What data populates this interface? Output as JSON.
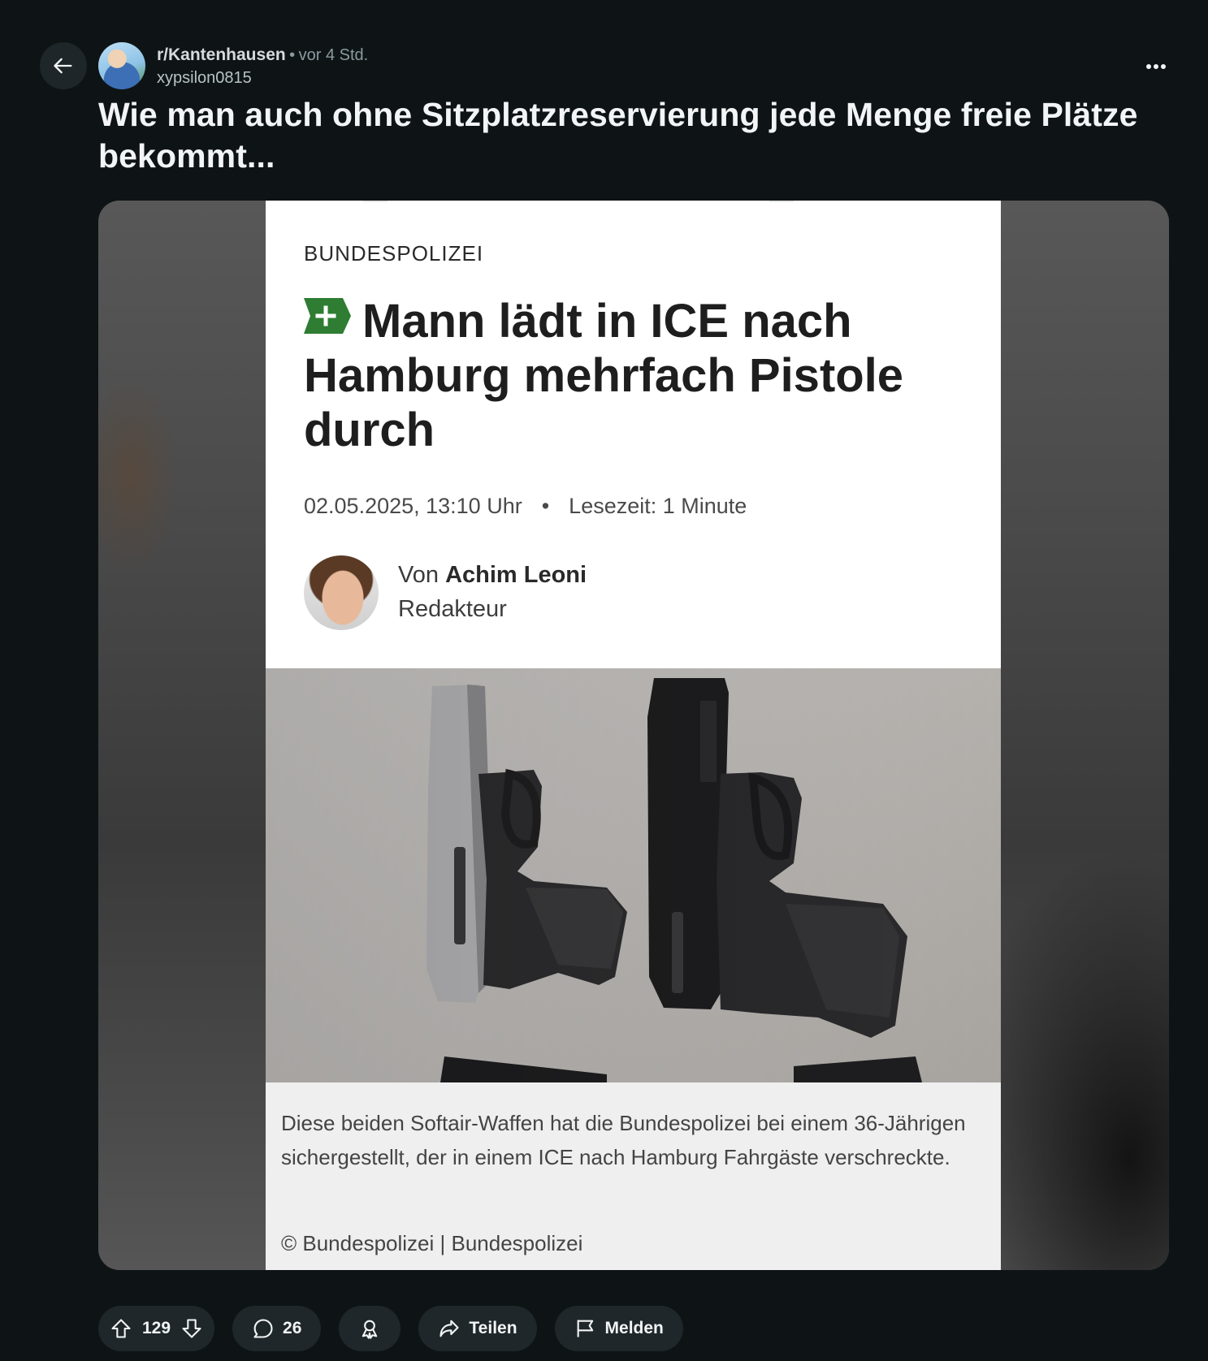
{
  "header": {
    "subreddit": "r/Kantenhausen",
    "separator": "•",
    "time": "vor 4 Std.",
    "author": "xypsilon0815",
    "back_icon": "arrow-left-icon",
    "more_icon": "more-horizontal-icon"
  },
  "post": {
    "title": "Wie man auch ohne Sitzplatzreservierung jede Menge freie Plätze bekommt..."
  },
  "article": {
    "kicker": "BUNDESPOLIZEI",
    "plus_badge": "+",
    "headline": "Mann lädt in ICE nach Hamburg mehrfach Pistole durch",
    "date": "02.05.2025, 13:10 Uhr",
    "date_sep": "•",
    "reading_time": "Lesezeit: 1 Minute",
    "byline_prefix": "Von",
    "author_name": "Achim Leoni",
    "author_role": "Redakteur",
    "caption": "Diese beiden Softair-Waffen hat die Bundespolizei bei einem 36-Jährigen sichergestellt, der in einem ICE nach Hamburg Fahrgäste verschreckte.",
    "credit": "© Bundespolizei | Bundespolizei",
    "badge_color": "#2e7d32"
  },
  "actions": {
    "score": "129",
    "comments": "26",
    "share_label": "Teilen",
    "report_label": "Melden"
  }
}
